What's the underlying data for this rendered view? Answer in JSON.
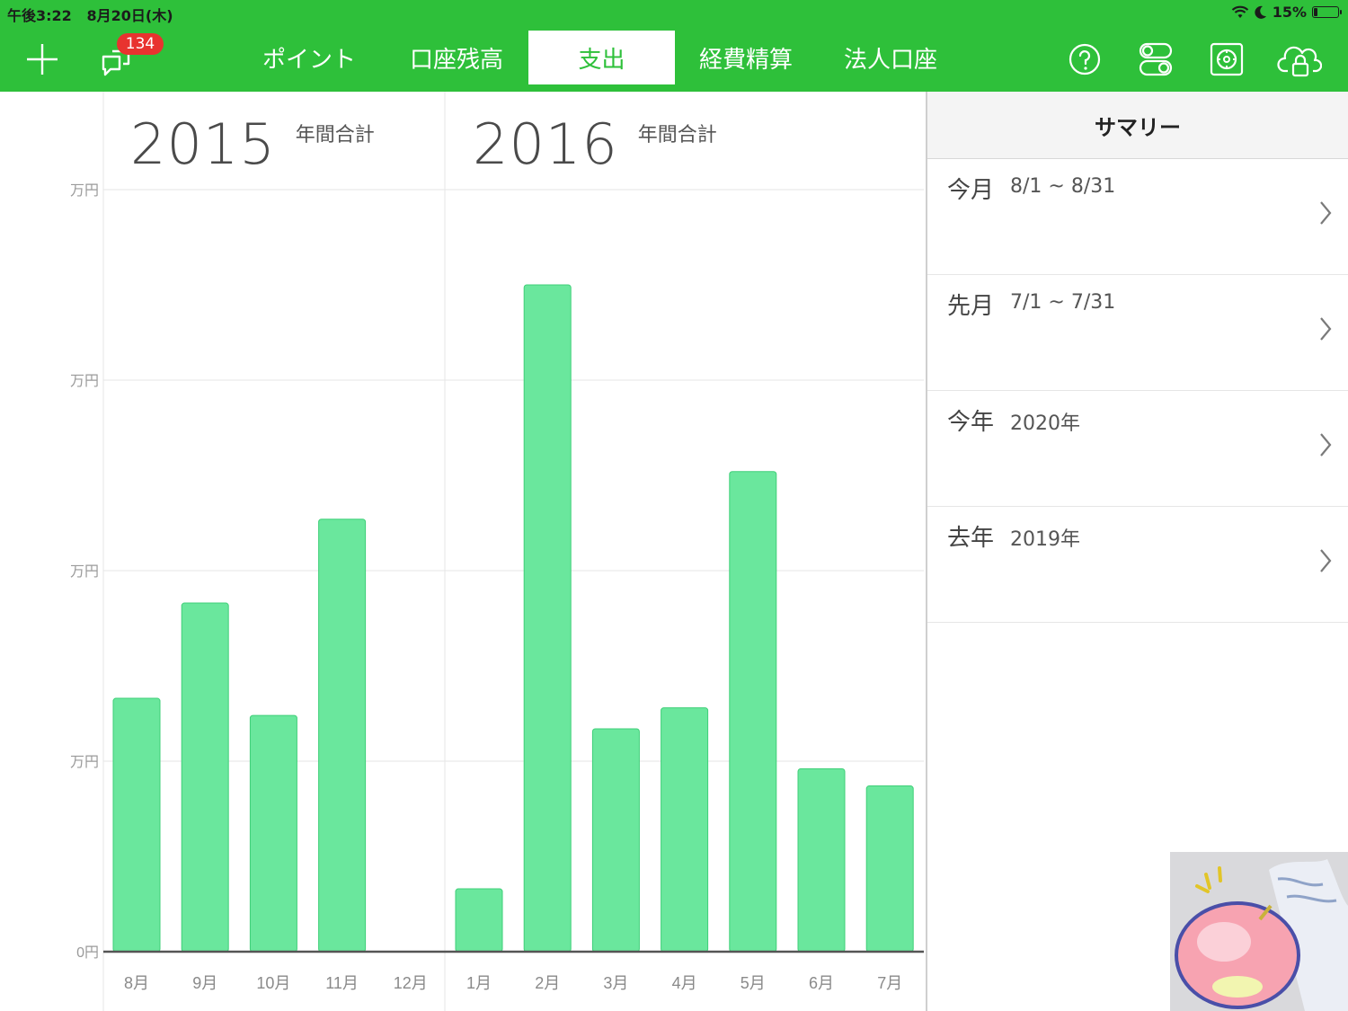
{
  "status_bar": {
    "time": "午後3:22",
    "date": "8月20日(木)",
    "battery": "15%",
    "battery_level": 0.15
  },
  "toolbar": {
    "notification_count": "134",
    "tabs": [
      {
        "label": "ポイント",
        "active": false
      },
      {
        "label": "口座残高",
        "active": false
      },
      {
        "label": "支出",
        "active": true
      },
      {
        "label": "経費精算",
        "active": false
      },
      {
        "label": "法人口座",
        "active": false
      }
    ],
    "icons": [
      "plus-icon",
      "notification-icon",
      "help-icon",
      "settings-toggle-icon",
      "vault-icon",
      "cloud-lock-icon"
    ]
  },
  "chart": {
    "year_sections": [
      {
        "year": "2015",
        "label": "年間合計"
      },
      {
        "year": "2016",
        "label": "年間合計"
      }
    ]
  },
  "chart_data": {
    "type": "bar",
    "title": "",
    "y_tick_labels": [
      "0円",
      "万円",
      "万円",
      "万円",
      "万円"
    ],
    "y_ticks": [
      0,
      1,
      2,
      3,
      4
    ],
    "ylim": [
      0,
      4
    ],
    "grid": true,
    "categories": [
      "8月",
      "9月",
      "10月",
      "11月",
      "12月",
      "1月",
      "2月",
      "3月",
      "4月",
      "5月",
      "6月",
      "7月"
    ],
    "values": [
      1.33,
      1.83,
      1.24,
      2.27,
      0,
      0.33,
      3.5,
      1.17,
      1.28,
      2.52,
      0.96,
      0.87
    ],
    "colors": {
      "bar": "#6ae79d",
      "bar_stroke": "#3fcf78"
    }
  },
  "summary": {
    "header": "サマリー",
    "rows": [
      {
        "title": "今月",
        "range": "8/1 ~ 8/31"
      },
      {
        "title": "先月",
        "range": "7/1 ~ 7/31"
      },
      {
        "title": "今年",
        "range": "2020年"
      },
      {
        "title": "去年",
        "range": "2019年"
      }
    ]
  },
  "colors": {
    "accent_green": "#2ec03a",
    "badge_red": "#e8332f"
  }
}
